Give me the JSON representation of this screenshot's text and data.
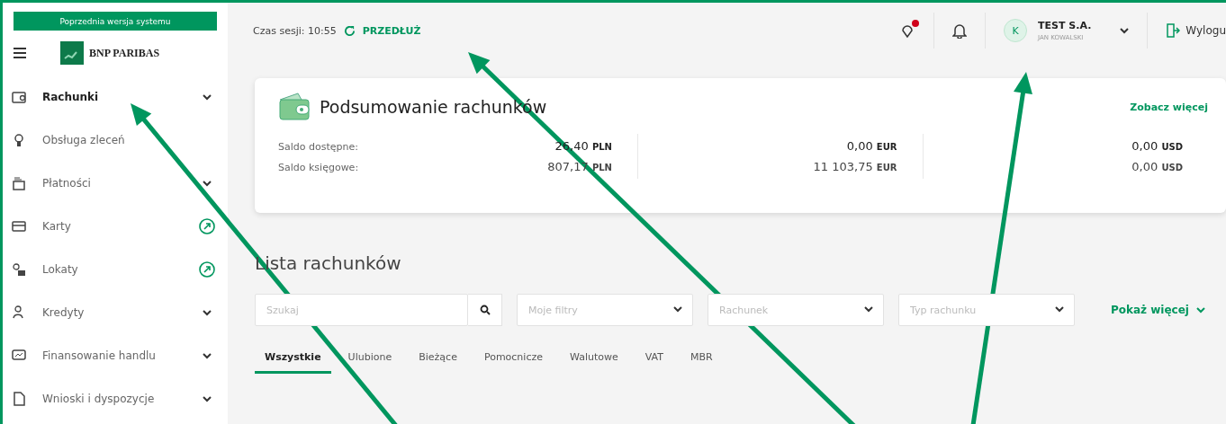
{
  "sidebar": {
    "legacy_button": "Poprzednia wersja systemu",
    "logo_text": "BNP PARIBAS",
    "items": [
      {
        "label": "Rachunki",
        "selected": true,
        "kind": "chevron"
      },
      {
        "label": "Obsługa zleceń",
        "selected": false,
        "kind": "plain"
      },
      {
        "label": "Płatności",
        "selected": false,
        "kind": "chevron"
      },
      {
        "label": "Karty",
        "selected": false,
        "kind": "external"
      },
      {
        "label": "Lokaty",
        "selected": false,
        "kind": "external"
      },
      {
        "label": "Kredyty",
        "selected": false,
        "kind": "chevron"
      },
      {
        "label": "Finansowanie handlu",
        "selected": false,
        "kind": "chevron"
      },
      {
        "label": "Wnioski i dyspozycje",
        "selected": false,
        "kind": "chevron"
      }
    ]
  },
  "header": {
    "session_label": "Czas sesji: 10:55",
    "extend": "PRZEDŁUŻ",
    "avatar": "K",
    "company": "TEST S.A.",
    "user": "JAN KOWALSKI",
    "logout": "Wylogu"
  },
  "summary": {
    "title": "Podsumowanie rachunków",
    "more": "Zobacz więcej",
    "available_label": "Saldo dostępne:",
    "booked_label": "Saldo księgowe:",
    "columns": [
      {
        "available": "26,40",
        "available_currency": "PLN",
        "booked": "807,17",
        "booked_currency": "PLN"
      },
      {
        "available": "0,00",
        "available_currency": "EUR",
        "booked": "11 103,75",
        "booked_currency": "EUR"
      },
      {
        "available": "0,00",
        "available_currency": "USD",
        "booked": "0,00",
        "booked_currency": "USD"
      }
    ]
  },
  "accounts": {
    "title": "Lista rachunków",
    "search": {
      "placeholder": "Szukaj"
    },
    "filters": [
      {
        "placeholder": "Moje filtry"
      },
      {
        "placeholder": "Rachunek"
      },
      {
        "placeholder": "Typ rachunku"
      }
    ],
    "more": "Pokaż więcej",
    "tabs": [
      {
        "label": "Wszystkie",
        "selected": true
      },
      {
        "label": "Ulubione",
        "selected": false
      },
      {
        "label": "Bieżące",
        "selected": false
      },
      {
        "label": "Pomocnicze",
        "selected": false
      },
      {
        "label": "Walutowe",
        "selected": false
      },
      {
        "label": "VAT",
        "selected": false
      },
      {
        "label": "MBR",
        "selected": false
      }
    ]
  }
}
